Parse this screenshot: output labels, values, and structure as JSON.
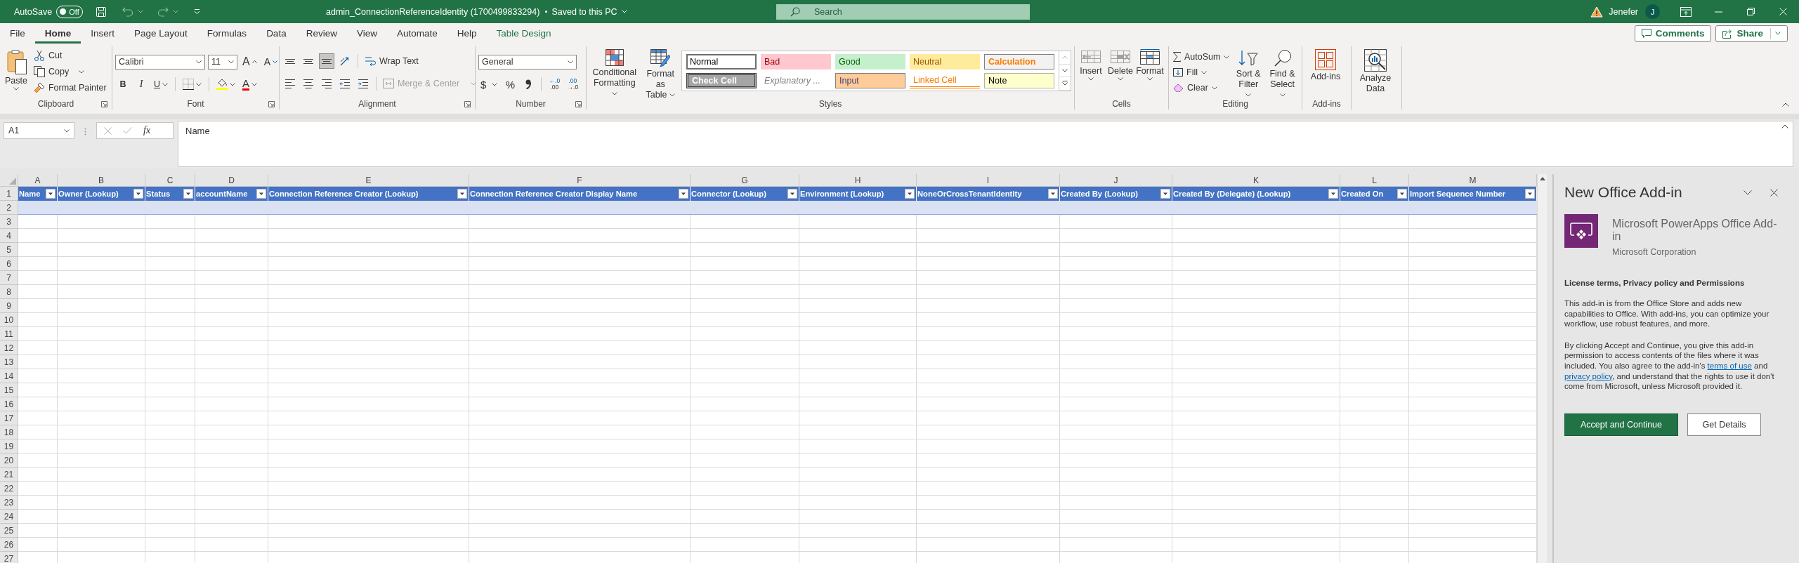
{
  "title_bar": {
    "autosave_label": "AutoSave",
    "autosave_on": false,
    "autosave_state": "Off",
    "document_title": "admin_ConnectionReferenceIdentity (1700499833294)",
    "save_status": "Saved to this PC",
    "search_placeholder": "Search",
    "user_name": "Jenefer",
    "user_initial": "J"
  },
  "menu_tabs": [
    {
      "label": "File",
      "selected": false,
      "kind": "standard"
    },
    {
      "label": "Home",
      "selected": true,
      "kind": "standard"
    },
    {
      "label": "Insert",
      "selected": false,
      "kind": "standard"
    },
    {
      "label": "Page Layout",
      "selected": false,
      "kind": "standard"
    },
    {
      "label": "Formulas",
      "selected": false,
      "kind": "standard"
    },
    {
      "label": "Data",
      "selected": false,
      "kind": "standard"
    },
    {
      "label": "Review",
      "selected": false,
      "kind": "standard"
    },
    {
      "label": "View",
      "selected": false,
      "kind": "standard"
    },
    {
      "label": "Automate",
      "selected": false,
      "kind": "standard"
    },
    {
      "label": "Help",
      "selected": false,
      "kind": "standard"
    },
    {
      "label": "Table Design",
      "selected": false,
      "kind": "contextual"
    }
  ],
  "header_buttons": [
    {
      "label": "Comments",
      "kind": "comments"
    },
    {
      "label": "Share",
      "kind": "share"
    }
  ],
  "ribbon": {
    "clipboard": {
      "label": "Clipboard",
      "paste": "Paste",
      "cut": "Cut",
      "copy": "Copy",
      "format_painter": "Format Painter"
    },
    "font": {
      "label": "Font",
      "font_name": "Calibri",
      "font_size": "11",
      "grow": "A",
      "shrink": "A",
      "bold": "B",
      "italic": "I",
      "underline": "U",
      "font_color": "A"
    },
    "alignment": {
      "label": "Alignment",
      "top_buttons": [
        {
          "kind": "top",
          "selected": false
        },
        {
          "kind": "middle",
          "selected": false
        },
        {
          "kind": "bottom",
          "selected": true
        },
        {
          "kind": "orientation",
          "selected": false
        }
      ],
      "bottom_buttons": [
        {
          "kind": "left",
          "selected": false
        },
        {
          "kind": "center",
          "selected": false
        },
        {
          "kind": "right",
          "selected": false
        },
        {
          "kind": "outdent",
          "selected": false
        },
        {
          "kind": "indent",
          "selected": false
        }
      ],
      "wrap_text": "Wrap Text",
      "merge_center": {
        "label": "Merge & Center",
        "disabled": true
      }
    },
    "number": {
      "label": "Number",
      "format": "General",
      "currency": "$",
      "percent": "%",
      "decimal_buttons": [
        {
          "top": "←.0",
          "bottom": ".00"
        },
        {
          "top": ".00",
          "bottom": "→.0"
        }
      ]
    },
    "styles": {
      "label": "Styles",
      "conditional_formatting": "Conditional Formatting",
      "format_as_table": "Format as Table",
      "cell_styles": [
        {
          "label": "Normal",
          "kind": "normal",
          "selected": true
        },
        {
          "label": "Bad",
          "kind": "bad",
          "selected": false
        },
        {
          "label": "Good",
          "kind": "good",
          "selected": false
        },
        {
          "label": "Neutral",
          "kind": "neutral",
          "selected": false
        },
        {
          "label": "Calculation",
          "kind": "calculation",
          "selected": false
        },
        {
          "label": "Check Cell",
          "kind": "check",
          "selected": false
        },
        {
          "label": "Explanatory ...",
          "kind": "explanatory",
          "selected": false
        },
        {
          "label": "Input",
          "kind": "input",
          "selected": false
        },
        {
          "label": "Linked Cell",
          "kind": "linked",
          "selected": false
        },
        {
          "label": "Note",
          "kind": "note",
          "selected": false
        }
      ]
    },
    "cells": {
      "label": "Cells",
      "buttons": [
        {
          "label": "Insert",
          "kind": "insert"
        },
        {
          "label": "Delete",
          "kind": "delete"
        },
        {
          "label": "Format",
          "kind": "format"
        }
      ]
    },
    "editing": {
      "label": "Editing",
      "autosum": "AutoSum",
      "fill": "Fill",
      "clear": "Clear",
      "sort_filter": "Sort & Filter",
      "find_select": "Find & Select"
    },
    "add_ins": {
      "label": "Add-ins",
      "button": "Add-ins"
    },
    "analysis": {
      "button": "Analyze Data"
    }
  },
  "formula_bar": {
    "name_box": "A1",
    "function_label": "fx",
    "content": "Name"
  },
  "sheet": {
    "columns": [
      {
        "letter": "A",
        "header": "Name"
      },
      {
        "letter": "B",
        "header": "Owner (Lookup)"
      },
      {
        "letter": "C",
        "header": "Status"
      },
      {
        "letter": "D",
        "header": "accountName"
      },
      {
        "letter": "E",
        "header": "Connection Reference Creator (Lookup)"
      },
      {
        "letter": "F",
        "header": "Connection Reference Creator Display Name"
      },
      {
        "letter": "G",
        "header": "Connector (Lookup)"
      },
      {
        "letter": "H",
        "header": "Environment (Lookup)"
      },
      {
        "letter": "I",
        "header": "NoneOrCrossTenantIdentity"
      },
      {
        "letter": "J",
        "header": "Created By (Lookup)"
      },
      {
        "letter": "K",
        "header": "Created By (Delegate) (Lookup)"
      },
      {
        "letter": "L",
        "header": "Created On"
      },
      {
        "letter": "M",
        "header": "Import Sequence Number"
      }
    ],
    "row_numbers": [
      "1",
      "2",
      "3",
      "4",
      "5",
      "6",
      "7",
      "8",
      "9",
      "10",
      "11",
      "12",
      "13",
      "14",
      "15",
      "16",
      "17",
      "18",
      "19",
      "20",
      "21",
      "22",
      "23",
      "24",
      "25",
      "26",
      "27"
    ]
  },
  "addin_pane": {
    "title": "New Office Add-in",
    "addin_name": "Microsoft PowerApps Office Add-in",
    "publisher": "Microsoft Corporation",
    "section_title": "License terms, Privacy policy and Permissions",
    "paragraph": "This add-in is from the Office Store and adds new capabilities to Office. With add-ins, you can optimize your workflow, use robust features, and more.",
    "consent": [
      {
        "text": "By clicking Accept and Continue, you give this add-in permission to access contents of the files where it was included. You also agree to the add-in's ",
        "kind": "text"
      },
      {
        "text": "terms of use",
        "kind": "link"
      },
      {
        "text": " and ",
        "kind": "text"
      },
      {
        "text": "privacy policy",
        "kind": "link"
      },
      {
        "text": ", and understand that the rights to use it don't come from Microsoft, unless Microsoft provided it.",
        "kind": "text"
      }
    ],
    "buttons": [
      {
        "label": "Accept and Continue",
        "kind": "primary"
      },
      {
        "label": "Get Details",
        "kind": "secondary"
      }
    ]
  }
}
